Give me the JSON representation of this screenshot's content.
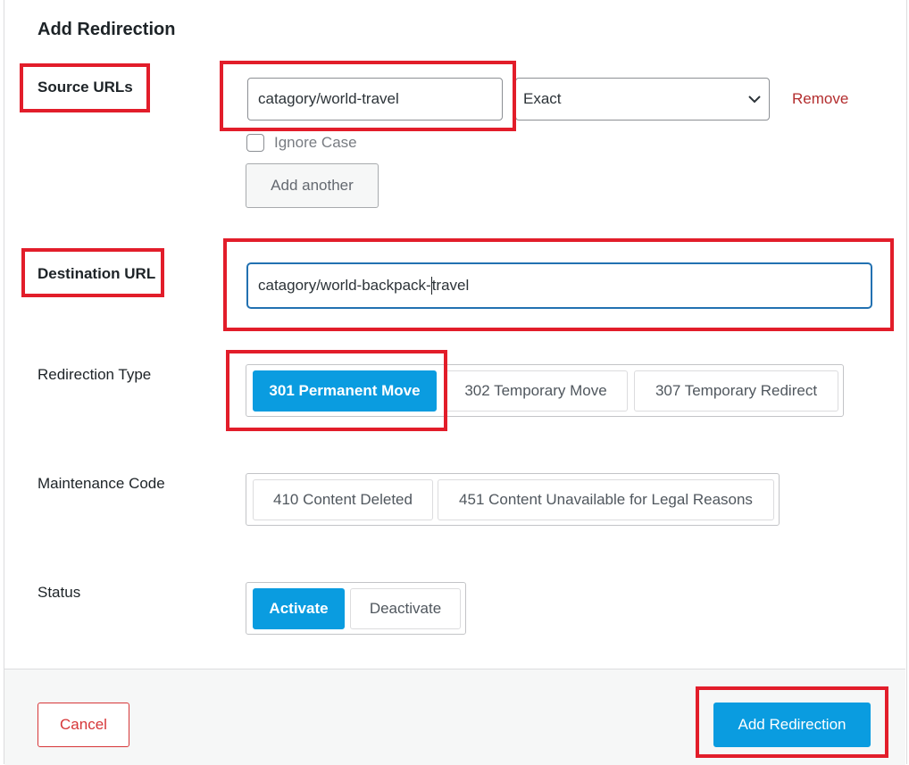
{
  "title": "Add Redirection",
  "source": {
    "label": "Source URLs",
    "url_value": "catagory/world-travel",
    "match_type": "Exact",
    "remove_label": "Remove",
    "ignore_case_label": "Ignore Case",
    "ignore_case_checked": false,
    "add_another_label": "Add another"
  },
  "destination": {
    "label": "Destination URL",
    "value_before_cursor": "catagory/world-backpack-",
    "value_after_cursor": "travel"
  },
  "redirection_type": {
    "label": "Redirection Type",
    "options": [
      "301 Permanent Move",
      "302 Temporary Move",
      "307 Temporary Redirect"
    ],
    "selected": "301 Permanent Move"
  },
  "maintenance_code": {
    "label": "Maintenance Code",
    "options": [
      "410 Content Deleted",
      "451 Content Unavailable for Legal Reasons"
    ]
  },
  "status": {
    "label": "Status",
    "options": [
      "Activate",
      "Deactivate"
    ],
    "selected": "Activate"
  },
  "footer": {
    "cancel_label": "Cancel",
    "submit_label": "Add Redirection"
  },
  "colors": {
    "accent": "#0a9ce0",
    "highlight": "#e21d2a",
    "danger": "#d63638"
  },
  "icons": {
    "select_arrow": "chevron-down-icon"
  }
}
